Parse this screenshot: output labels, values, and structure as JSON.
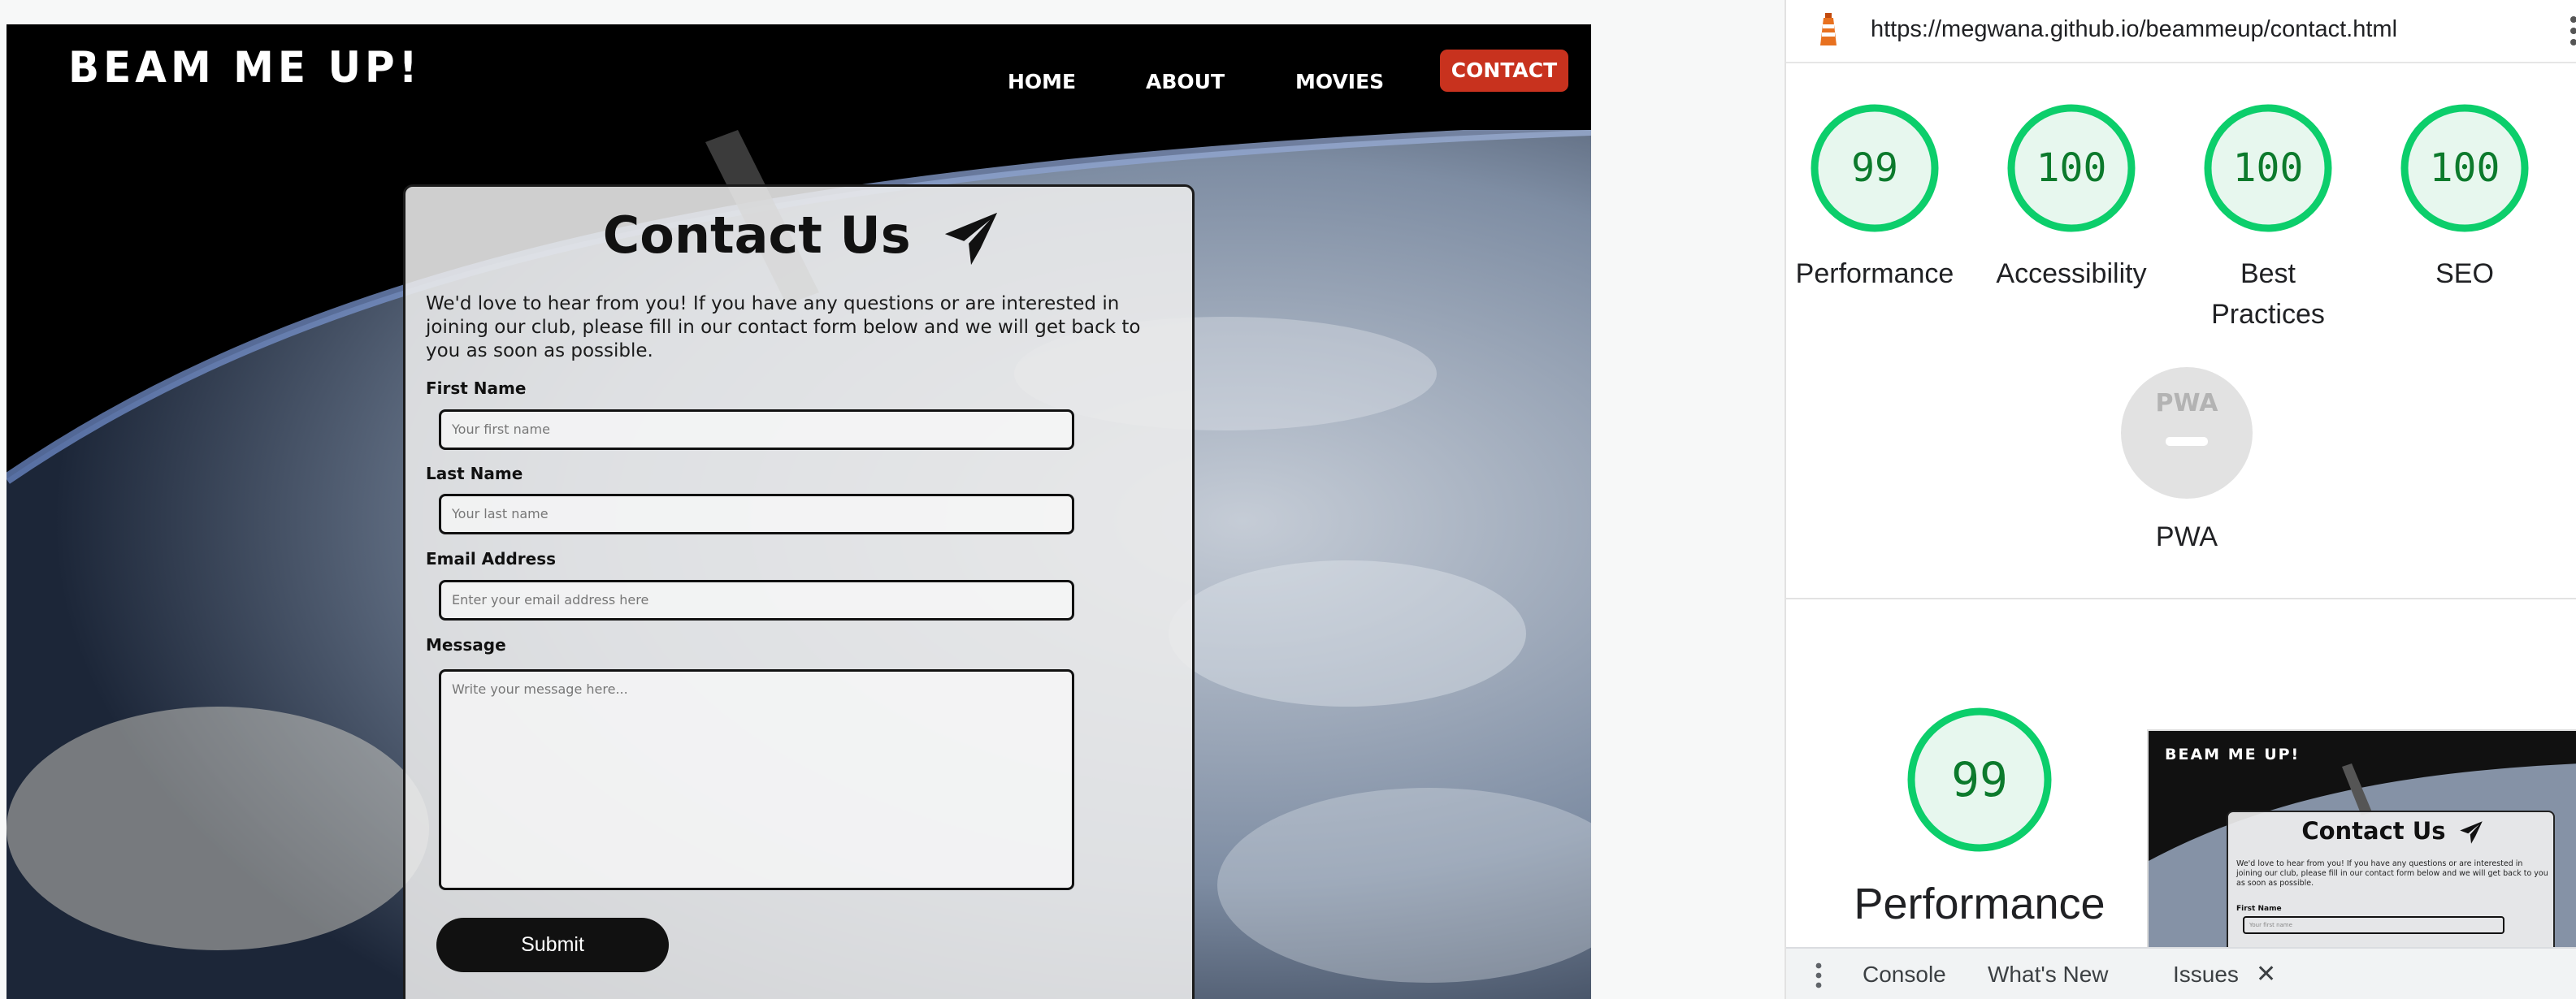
{
  "site": {
    "logo": "BEAM ME UP!",
    "nav": [
      "HOME",
      "ABOUT",
      "MOVIES",
      "CONTACT"
    ],
    "active_nav": "CONTACT",
    "contact": {
      "title": "Contact Us",
      "intro": "We'd love to hear from you! If you have any questions or are interested in joining our club, please fill in our contact form below and we will get back to you as soon as possible.",
      "fields": [
        {
          "label": "First Name",
          "placeholder": "Your first name"
        },
        {
          "label": "Last Name",
          "placeholder": "Your last name"
        },
        {
          "label": "Email Address",
          "placeholder": "Enter your email address here"
        },
        {
          "label": "Message",
          "placeholder": "Write your message here..."
        }
      ],
      "submit": "Submit"
    }
  },
  "devtools": {
    "url": "https://megwana.github.io/beammeup/contact.html",
    "scores": [
      {
        "label": "Performance",
        "value": "99"
      },
      {
        "label": "Accessibility",
        "value": "100"
      },
      {
        "label": "Best Practices",
        "value": "100"
      },
      {
        "label": "SEO",
        "value": "100"
      }
    ],
    "pwa_label": "PWA",
    "pwa_badge": "PWA",
    "summary": {
      "value": "99",
      "label": "Performance"
    },
    "thumbnail": {
      "logo": "BEAM ME UP!",
      "title": "Contact Us",
      "intro": "We'd love to hear from you! If you have any questions or are interested in joining our club, please fill in our contact form below and we will get back to you as soon as possible.",
      "first_label": "First Name",
      "first_placeholder": "Your first name"
    },
    "drawer_tabs": [
      "Console",
      "What's New",
      "Issues"
    ],
    "colors": {
      "pass": "#0cce6b",
      "pass_text": "#0c7a2c",
      "contact_button": "#c8321e"
    }
  }
}
